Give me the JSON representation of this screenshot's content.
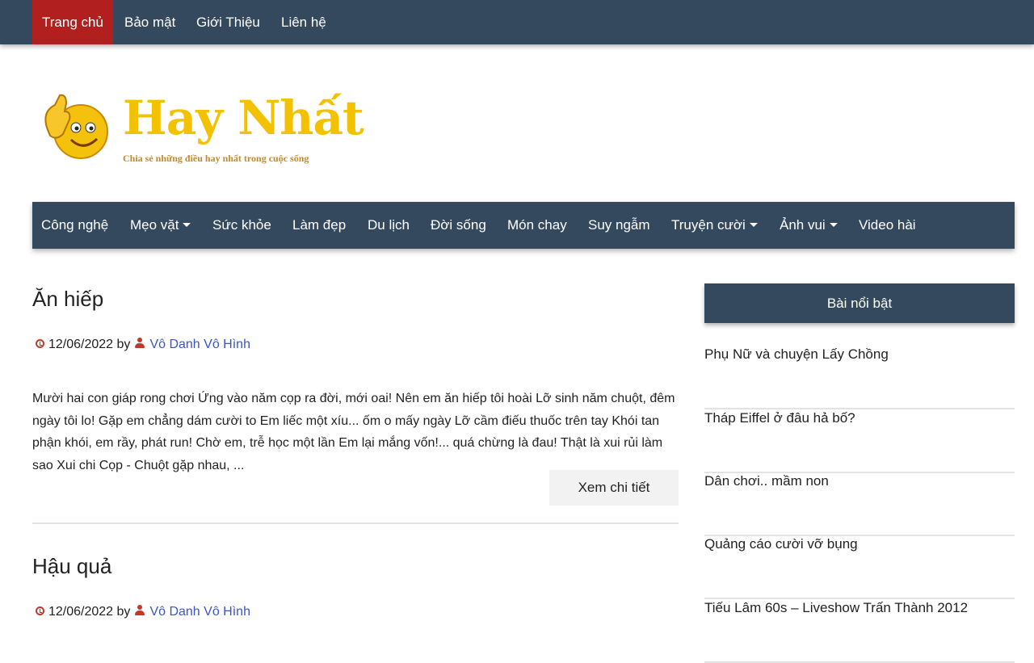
{
  "topnav": {
    "items": [
      {
        "label": "Trang chủ",
        "active": true
      },
      {
        "label": "Bảo mật"
      },
      {
        "label": "Giới Thiệu"
      },
      {
        "label": "Liên hệ"
      }
    ]
  },
  "logo": {
    "title": "Hay Nhất",
    "tagline": "Chia sẻ những điều hay nhất trong cuộc sống",
    "icon": "thumbs-up-smiley-icon"
  },
  "mainnav": {
    "items": [
      {
        "label": "Công nghệ"
      },
      {
        "label": "Mẹo vặt",
        "dropdown": true
      },
      {
        "label": "Sức khỏe"
      },
      {
        "label": "Làm đẹp"
      },
      {
        "label": "Du lịch"
      },
      {
        "label": "Đời sống"
      },
      {
        "label": "Món chay"
      },
      {
        "label": "Suy ngẫm"
      },
      {
        "label": "Truyện cười",
        "dropdown": true
      },
      {
        "label": "Ảnh vui",
        "dropdown": true
      },
      {
        "label": "Video hài"
      }
    ]
  },
  "posts": [
    {
      "title": "Ăn hiếp",
      "date": "12/06/2022",
      "by": "by",
      "author": "Vô Danh Vô Hình",
      "excerpt": "Mười hai con giáp rong chơi Ứng vào năm cọp ra đời, mới oai! Nên em ăn hiếp tôi hoài Lỡ sinh năm chuột, đêm ngày tôi lo! Gặp em chẳng dám cười to Em liếc một xíu... ốm o mấy ngày Lỡ cầm điếu thuốc trên tay Khói tan phận khói, em rầy, phát run! Chờ em, trễ học một lần Em lại mắng vốn!... quá chừng là đau! Thật là xui rủi làm sao Xui chi Cọp - Chuột gặp nhau, ...",
      "more": "Xem chi tiết"
    },
    {
      "title": "Hậu quả",
      "date": "12/06/2022",
      "by": "by",
      "author": "Vô Danh Vô Hình"
    }
  ],
  "sidebar": {
    "heading": "Bài nổi bật",
    "items": [
      "Phụ Nữ và chuyện Lấy Chồng",
      "Tháp Eiffel ở đâu hả bố?",
      "Dân chơi.. mầm non",
      "Quảng cáo cười vỡ bụng",
      "Tiếu Lâm 60s – Liveshow Trấn Thành 2012"
    ]
  },
  "colors": {
    "nav_bg": "#34495e",
    "active_bg": "#b21f1f",
    "logo_gold": "#f2c200",
    "author_link": "#3a55c9",
    "meta_icon": "#c0392b"
  }
}
